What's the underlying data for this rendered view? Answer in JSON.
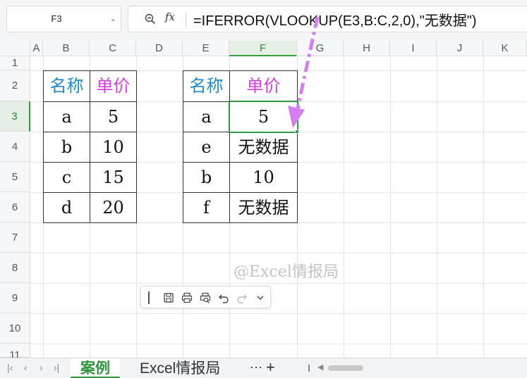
{
  "formula_bar": {
    "name_box": "F3",
    "formula": "=IFERROR(VLOOKUP(E3,B:C,2,0),\"无数据\")"
  },
  "columns": [
    "A",
    "B",
    "C",
    "D",
    "E",
    "F",
    "G",
    "H",
    "I",
    "J",
    "K"
  ],
  "rows": [
    "1",
    "2",
    "3",
    "4",
    "5",
    "6",
    "7",
    "8",
    "9",
    "10",
    "11"
  ],
  "active_column": "F",
  "active_row": "3",
  "source_table": {
    "headers": [
      "名称",
      "单价"
    ],
    "rows": [
      [
        "a",
        "5"
      ],
      [
        "b",
        "10"
      ],
      [
        "c",
        "15"
      ],
      [
        "d",
        "20"
      ]
    ]
  },
  "lookup_table": {
    "headers": [
      "名称",
      "单价"
    ],
    "rows": [
      [
        "a",
        "5"
      ],
      [
        "e",
        "无数据"
      ],
      [
        "b",
        "10"
      ],
      [
        "f",
        "无数据"
      ]
    ]
  },
  "watermark": "@Excel情报局",
  "sheet_tabs": {
    "tabs": [
      "案例",
      "Excel情报局"
    ],
    "more": "···",
    "add": "+"
  },
  "colors": {
    "header_blue": "#1f8ad1",
    "header_pink": "#d63ae2",
    "accent_green": "#2f9a3f",
    "arrow_violet": "#d47ef2"
  },
  "icons": [
    "zoom-icon",
    "fx-icon",
    "save-icon",
    "print-icon",
    "print-preview-icon",
    "undo-icon",
    "redo-icon",
    "chevron-down-icon"
  ]
}
